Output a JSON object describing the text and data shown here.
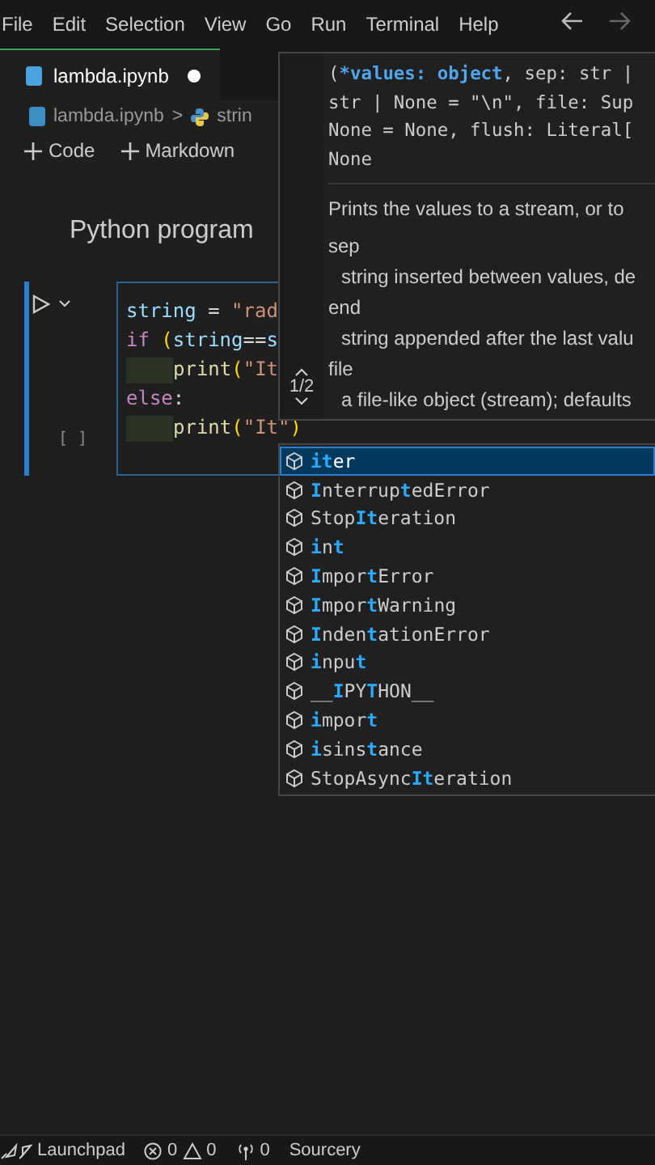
{
  "menu": [
    "File",
    "Edit",
    "Selection",
    "View",
    "Go",
    "Run",
    "Terminal",
    "Help"
  ],
  "tab": {
    "label": "lambda.ipynb",
    "modified": true
  },
  "breadcrumb": {
    "file": "lambda.ipynb",
    "separator": ">",
    "symbol": "strin"
  },
  "toolbar": [
    "Code",
    "Markdown"
  ],
  "markdown_cell": "Python program",
  "code_cell": {
    "execution_count": "[ ]",
    "lines": [
      {
        "indented": false,
        "tokens": [
          {
            "kind": "var",
            "text": "string"
          },
          {
            "kind": "plain",
            "text": " = "
          },
          {
            "kind": "string",
            "text": "\"rad"
          }
        ]
      },
      {
        "indented": false,
        "tokens": [
          {
            "kind": "keyword",
            "text": "if"
          },
          {
            "kind": "bracket",
            "text": " ("
          },
          {
            "kind": "var",
            "text": "string"
          },
          {
            "kind": "plain",
            "text": "=="
          },
          {
            "kind": "var",
            "text": "s"
          }
        ]
      },
      {
        "indented": true,
        "tokens": [
          {
            "kind": "func",
            "text": "print"
          },
          {
            "kind": "bracket",
            "text": "("
          },
          {
            "kind": "string",
            "text": "\"It"
          }
        ]
      },
      {
        "indented": false,
        "tokens": [
          {
            "kind": "keyword",
            "text": "else"
          },
          {
            "kind": "plain",
            "text": ":"
          }
        ]
      },
      {
        "indented": true,
        "tokens": [
          {
            "kind": "func",
            "text": "print"
          },
          {
            "kind": "bracket",
            "text": "("
          },
          {
            "kind": "string",
            "text": "\"It\""
          },
          {
            "kind": "bracket",
            "text": ")"
          }
        ]
      }
    ]
  },
  "hover": {
    "overload": "1/2",
    "signature": [
      [
        {
          "text": "(",
          "param": false
        },
        {
          "text": "*values: object",
          "param": true
        },
        {
          "text": ", sep: str |",
          "param": false
        }
      ],
      [
        {
          "text": "str | None = \"\\n\", file: Sup",
          "param": false
        }
      ],
      [
        {
          "text": "None = None, flush: Literal[",
          "param": false
        }
      ],
      [
        {
          "text": "None",
          "param": false
        }
      ]
    ],
    "description": "Prints the values to a stream, or to",
    "params": [
      {
        "name": "sep",
        "doc": "string inserted between values, de"
      },
      {
        "name": "end",
        "doc": "string appended after the last valu"
      },
      {
        "name": "file",
        "doc": "a file-like object (stream); defaults"
      }
    ]
  },
  "suggestions": [
    {
      "label": "**it**er",
      "selected": true
    },
    {
      "label": "**I**nterrup**t**edError",
      "selected": false
    },
    {
      "label": "Stop**It**eration",
      "selected": false
    },
    {
      "label": "**i**n**t**",
      "selected": false
    },
    {
      "label": "**I**mpor**t**Error",
      "selected": false
    },
    {
      "label": "**I**mpor**t**Warning",
      "selected": false
    },
    {
      "label": "**I**nden**t**ationError",
      "selected": false
    },
    {
      "label": "**i**npu**t**",
      "selected": false
    },
    {
      "label": "__**I**PY**T**HON__",
      "selected": false
    },
    {
      "label": "**i**mpor**t**",
      "selected": false
    },
    {
      "label": "**i**sins**t**ance",
      "selected": false
    },
    {
      "label": "StopAsync**It**eration",
      "selected": false
    }
  ],
  "status_bar": {
    "launchpad": "Launchpad",
    "errors": "0",
    "warnings": "0",
    "ports": "0",
    "extension": "Sourcery"
  }
}
